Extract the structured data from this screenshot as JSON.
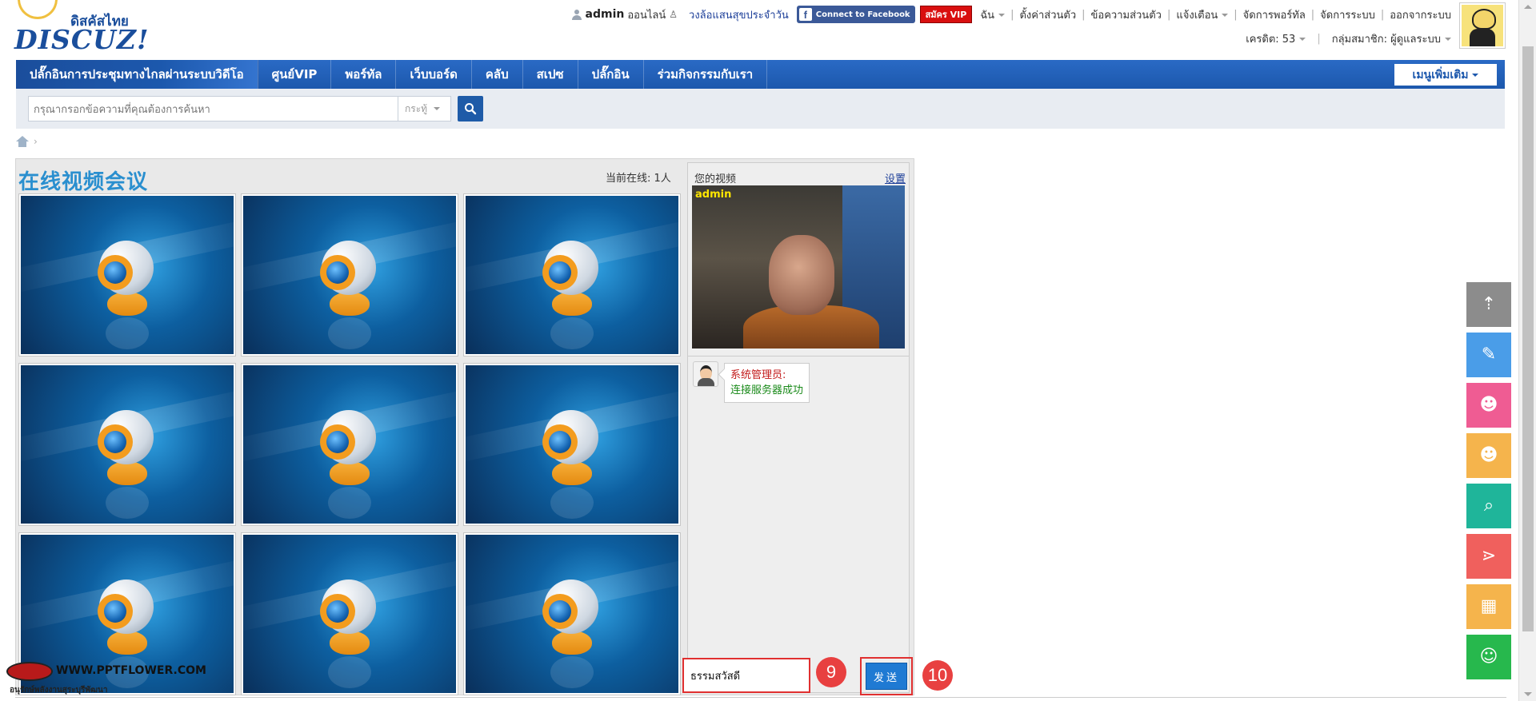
{
  "header": {
    "logo_thai": "ดิสคัสไทย",
    "logo_word": "DISCUZ!",
    "username": "admin",
    "online_label": "ออนไลน์",
    "lucky_wheel": "วงล้อแสนสุขประจำวัน",
    "facebook_button": "Connect to Facebook",
    "vip_button": "สมัคร VIP",
    "links": [
      "ฉัน",
      "ตั้งค่าส่วนตัว",
      "ข้อความส่วนตัว",
      "แจ้งเตือน",
      "จัดการพอร์ทัล",
      "จัดการระบบ",
      "ออกจากระบบ"
    ],
    "credits": "เครดิต: 53",
    "user_group": "กลุ่มสมาชิก: ผู้ดูแลระบบ"
  },
  "nav": {
    "items": [
      "ปลั๊กอินการประชุมทางไกลผ่านระบบวิดีโอ",
      "ศูนย์VIP",
      "พอร์ทัล",
      "เว็บบอร์ด",
      "คลับ",
      "สเปซ",
      "ปลั๊กอิน",
      "ร่วมกิจกรรมกับเรา"
    ],
    "more": "เมนูเพิ่มเติม"
  },
  "search": {
    "placeholder": "กรุณากรอกข้อความที่คุณต้องการค้นหา",
    "type": "กระทู้"
  },
  "conference": {
    "title": "在线视频会议",
    "online_count": "当前在线: 1人",
    "your_video": "您的视频",
    "settings": "设置",
    "video_user": "admin",
    "message_sender": "系统管理员:",
    "message_text": "连接服务器成功",
    "input_value": "ธรรมสวัสดี",
    "send_button": "发送",
    "slots": 9
  },
  "steps": {
    "input_step": "9",
    "send_step": "10"
  },
  "watermark": {
    "site": "WWW.PPTFLOWER.COM",
    "sub": "อนุรักษ์พลังงานสุระบุรีพัฒนา"
  },
  "tools": [
    {
      "icon": "back-to-top-icon",
      "color": "#8c8c8c",
      "glyph": "⇡"
    },
    {
      "icon": "post-icon",
      "color": "#4a9de8",
      "glyph": "✎"
    },
    {
      "icon": "checkin-icon",
      "color": "#ef5c93",
      "glyph": "☻"
    },
    {
      "icon": "task-icon",
      "color": "#f5b44c",
      "glyph": "☻"
    },
    {
      "icon": "search-icon",
      "color": "#1fb59a",
      "glyph": "⌕"
    },
    {
      "icon": "share-icon",
      "color": "#f0605d",
      "glyph": "⋗"
    },
    {
      "icon": "qrcode-icon",
      "color": "#f5b44c",
      "glyph": "▦"
    },
    {
      "icon": "contact-icon",
      "color": "#27b84d",
      "glyph": "☺"
    }
  ]
}
